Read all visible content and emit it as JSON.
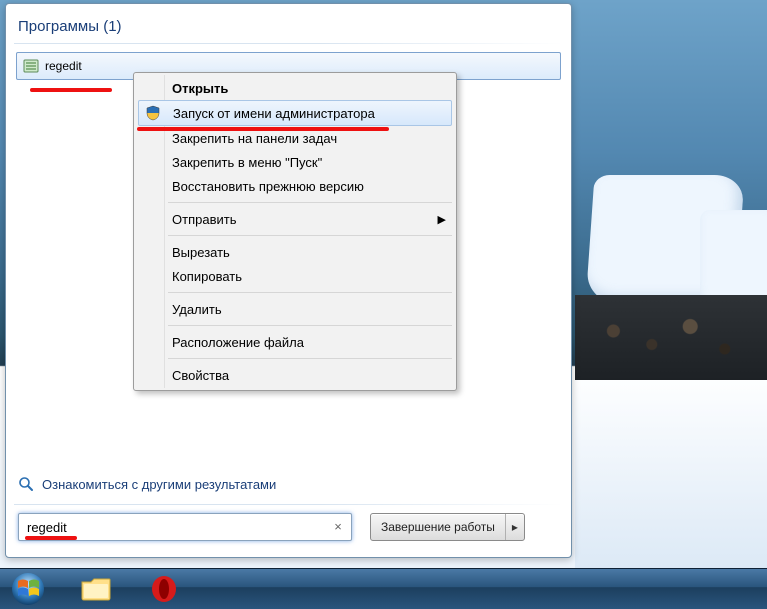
{
  "section": {
    "title": "Программы",
    "count": "(1)"
  },
  "result": {
    "label": "regedit"
  },
  "context_menu": {
    "open": "Открыть",
    "run_as_admin": "Запуск от имени администратора",
    "pin_taskbar": "Закрепить на панели задач",
    "pin_startmenu": "Закрепить в меню \"Пуск\"",
    "restore_prev": "Восстановить прежнюю версию",
    "send_to": "Отправить",
    "cut": "Вырезать",
    "copy": "Копировать",
    "delete": "Удалить",
    "file_location": "Расположение файла",
    "properties": "Свойства"
  },
  "see_more": "Ознакомиться с другими результатами",
  "search": {
    "value": "regedit"
  },
  "shutdown": {
    "label": "Завершение работы"
  }
}
